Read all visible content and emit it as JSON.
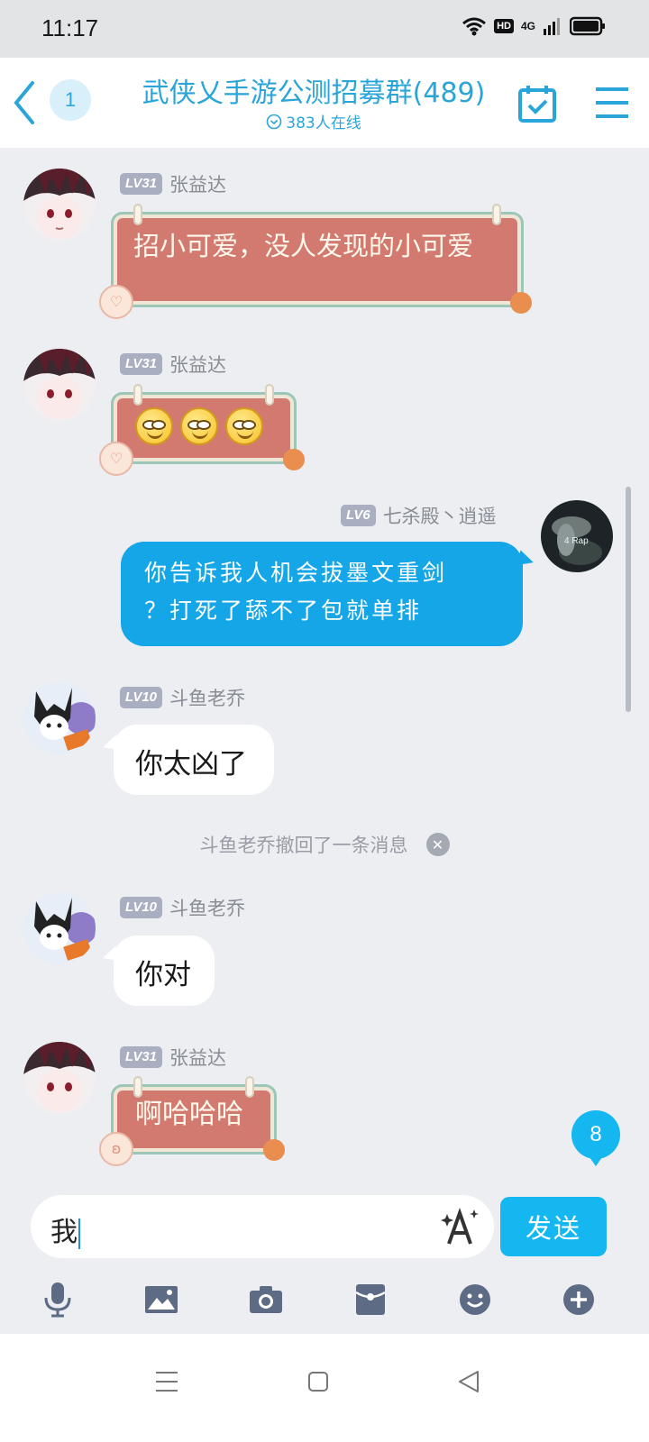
{
  "status_bar": {
    "time": "11:17",
    "hd_badge": "HD",
    "network": "4G",
    "icons": [
      "wifi-icon",
      "hd-icon",
      "signal-4g-icon",
      "battery-icon"
    ]
  },
  "header": {
    "back_icon": "chevron-left-icon",
    "unread_count": "1",
    "title": "武侠乂手游公测招募群(489)",
    "online_status": "383人在线",
    "calendar_icon": "calendar-check-icon",
    "menu_icon": "hamburger-menu-icon"
  },
  "messages": [
    {
      "level": "LV31",
      "sender": "张益达",
      "text": "招小可爱，没人发现的小可爱",
      "side": "left",
      "style": "decorated"
    },
    {
      "level": "LV31",
      "sender": "张益达",
      "emoji_count": 3,
      "side": "left",
      "style": "decorated-emoji"
    },
    {
      "level": "LV6",
      "sender": "七杀殿丶逍遥",
      "text_line1": "你告诉我人机会拔墨文重剑",
      "text_line2": "？打死了舔不了包就单排",
      "side": "right",
      "style": "blue"
    },
    {
      "level": "LV10",
      "sender": "斗鱼老乔",
      "text": "你太凶了",
      "side": "left",
      "style": "plain"
    },
    {
      "level": "LV10",
      "sender": "斗鱼老乔",
      "text": "你对",
      "side": "left",
      "style": "plain"
    },
    {
      "level": "LV31",
      "sender": "张益达",
      "text": "啊哈哈哈",
      "side": "left",
      "style": "decorated"
    }
  ],
  "avatars": {
    "right_avatar_caption": "4 Rap"
  },
  "system_notice": {
    "text": "斗鱼老乔撤回了一条消息"
  },
  "new_message_badge": "8",
  "input": {
    "value": "我"
  },
  "send_button": "发送",
  "toolbar": {
    "items": [
      "microphone-icon",
      "image-icon",
      "camera-icon",
      "red-packet-icon",
      "emoji-icon",
      "plus-icon"
    ]
  },
  "nav_bar": {
    "items": [
      "menu-nav-icon",
      "home-nav-icon",
      "back-nav-icon"
    ]
  },
  "colors": {
    "accent": "#2aa5d9",
    "send": "#14b7ef",
    "bubble_blue": "#14a6e6",
    "deco_bubble": "#d27a70"
  }
}
